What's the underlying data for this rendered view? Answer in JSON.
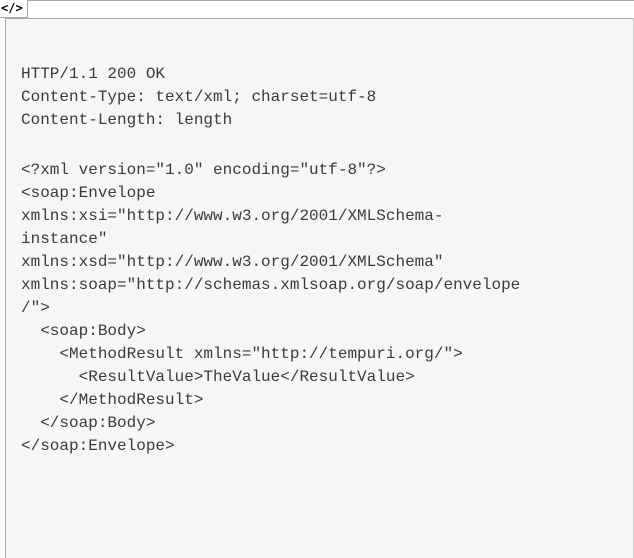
{
  "tab": {
    "label": "</>"
  },
  "code": {
    "lines": [
      "HTTP/1.1 200 OK",
      "Content-Type: text/xml; charset=utf-8",
      "Content-Length: length",
      "",
      "<?xml version=\"1.0\" encoding=\"utf-8\"?>",
      "<soap:Envelope",
      "xmlns:xsi=\"http://www.w3.org/2001/XMLSchema-",
      "instance\"",
      "xmlns:xsd=\"http://www.w3.org/2001/XMLSchema\"",
      "xmlns:soap=\"http://schemas.xmlsoap.org/soap/envelope",
      "/\">",
      "  <soap:Body>",
      "    <MethodResult xmlns=\"http://tempuri.org/\">",
      "      <ResultValue>TheValue</ResultValue>",
      "    </MethodResult>",
      "  </soap:Body>",
      "</soap:Envelope>"
    ]
  }
}
